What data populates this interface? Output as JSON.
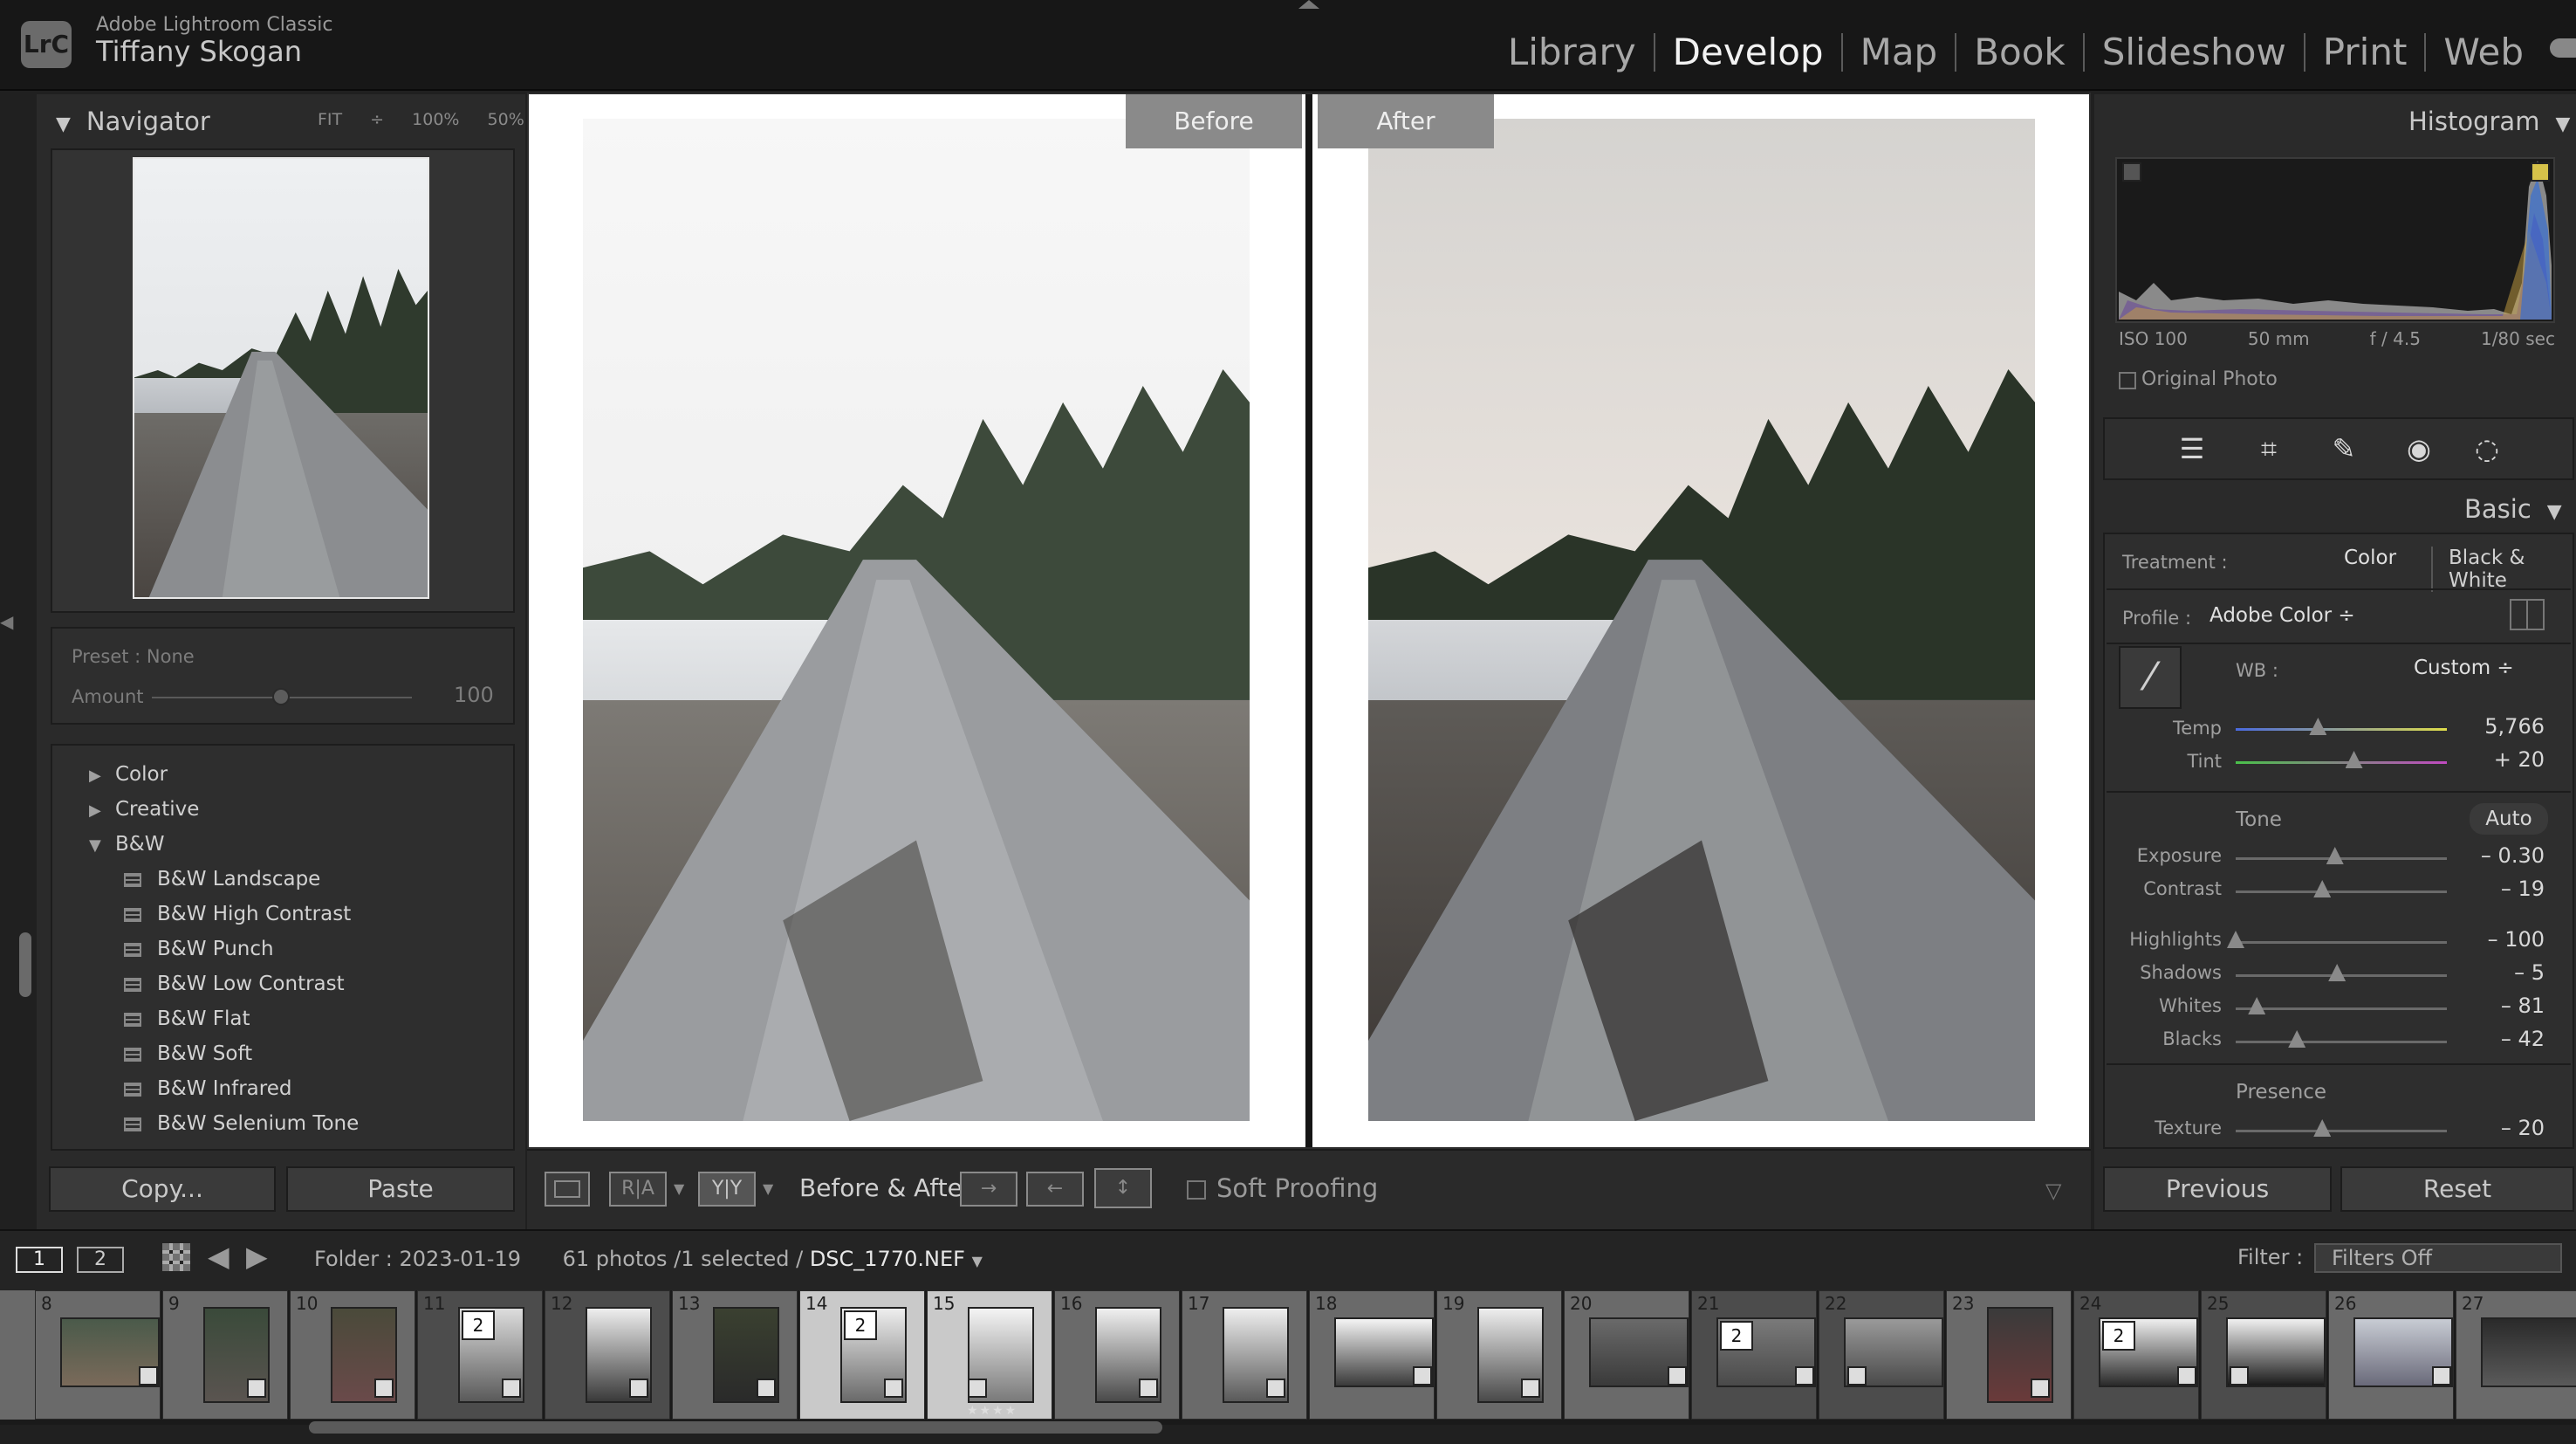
{
  "app": {
    "logo": "LrC",
    "name": "Adobe Lightroom Classic",
    "user": "Tiffany Skogan"
  },
  "modules": [
    "Library",
    "Develop",
    "Map",
    "Book",
    "Slideshow",
    "Print",
    "Web"
  ],
  "active_module": "Develop",
  "navigator": {
    "title": "Navigator",
    "zoom_fit": "FIT ÷",
    "zoom_100": "100%",
    "zoom_50": "50%",
    "zoom_more": "÷"
  },
  "preset": {
    "label": "Preset : None",
    "amount_label": "Amount",
    "amount_value": "100"
  },
  "preset_groups": [
    {
      "label": "Color",
      "expanded": false
    },
    {
      "label": "Creative",
      "expanded": false
    },
    {
      "label": "B&W",
      "expanded": true
    }
  ],
  "preset_items": [
    "B&W Landscape",
    "B&W High Contrast",
    "B&W Punch",
    "B&W Low Contrast",
    "B&W Flat",
    "B&W Soft",
    "B&W Infrared",
    "B&W Selenium Tone"
  ],
  "left_buttons": {
    "copy": "Copy...",
    "paste": "Paste"
  },
  "view": {
    "before_label": "Before",
    "after_label": "After"
  },
  "toolbar": {
    "loupe": "",
    "ra": "R|A",
    "yy": "Y|Y",
    "before_after_label": "Before & After :",
    "soft_proofing": "Soft Proofing"
  },
  "histogram": {
    "title": "Histogram",
    "iso": "ISO 100",
    "focal": "50 mm",
    "aperture": "f / 4.5",
    "shutter": "1/80 sec",
    "original_photo": "Original Photo"
  },
  "basic": {
    "title": "Basic",
    "treatment_label": "Treatment :",
    "treatment_color": "Color",
    "treatment_bw": "Black & White",
    "profile_label": "Profile :",
    "profile_value": "Adobe Color ÷",
    "wb_label": "WB :",
    "wb_value": "Custom ÷",
    "temp_label": "Temp",
    "temp_value": "5,766",
    "temp_level": 0.39,
    "tint_label": "Tint",
    "tint_value": "+ 20",
    "tint_level": 0.56,
    "tone_label": "Tone",
    "auto_label": "Auto",
    "exposure_label": "Exposure",
    "exposure_value": "– 0.30",
    "exposure_level": 0.47,
    "contrast_label": "Contrast",
    "contrast_value": "– 19",
    "contrast_level": 0.41,
    "highlights_label": "Highlights",
    "highlights_value": "– 100",
    "highlights_level": 0.0,
    "shadows_label": "Shadows",
    "shadows_value": "– 5",
    "shadows_level": 0.48,
    "whites_label": "Whites",
    "whites_value": "– 81",
    "whites_level": 0.1,
    "blacks_label": "Blacks",
    "blacks_value": "– 42",
    "blacks_level": 0.29,
    "presence_label": "Presence",
    "texture_label": "Texture",
    "texture_value": "– 20",
    "texture_level": 0.41
  },
  "right_buttons": {
    "previous": "Previous",
    "reset": "Reset"
  },
  "filmbar": {
    "view1": "1",
    "view2": "2",
    "folder": "Folder : 2023-01-19",
    "count": "61 photos /1 selected /",
    "file": "DSC_1770.NEF",
    "filter_label": "Filter :",
    "filter_value": "Filters Off"
  },
  "filmstrip": {
    "numbers": [
      "8",
      "9",
      "10",
      "11",
      "12",
      "13",
      "14",
      "15",
      "16",
      "17",
      "18",
      "19",
      "20",
      "21",
      "22",
      "23",
      "24",
      "25",
      "26",
      "27"
    ],
    "stack_count": "2",
    "stars": "★★★★"
  },
  "colors": {
    "accent": "#f2f2f2",
    "panel": "#2a2a2a",
    "background": "#202020"
  }
}
